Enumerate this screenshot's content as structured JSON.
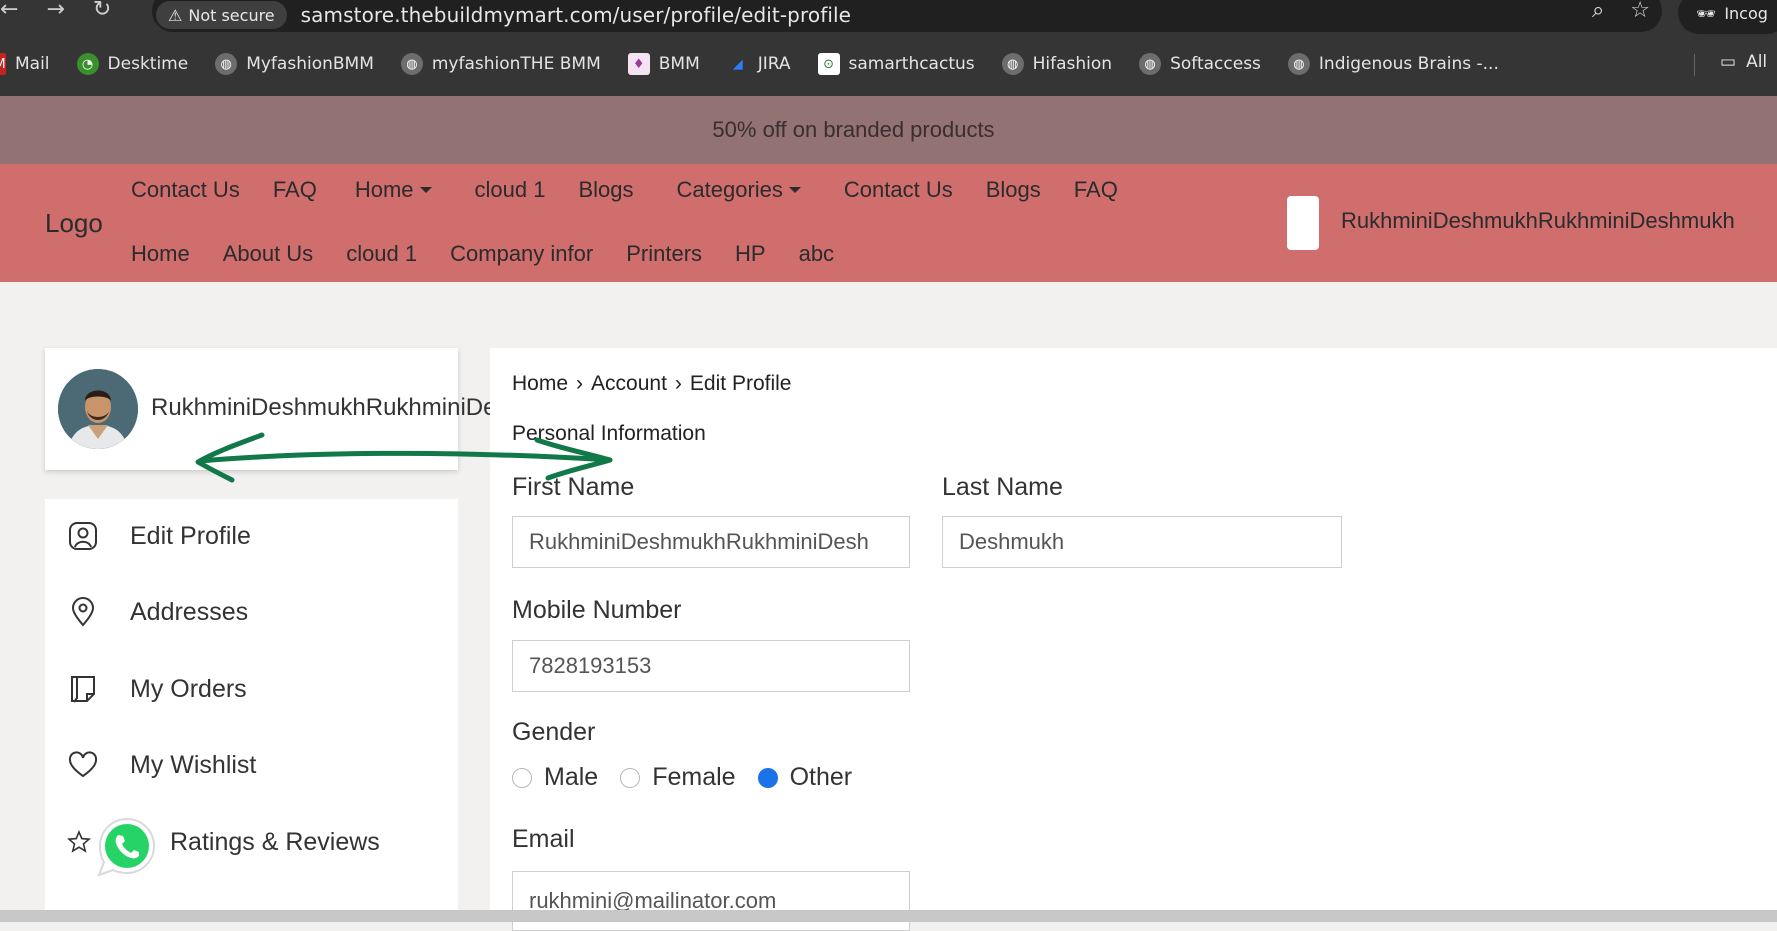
{
  "browser": {
    "security_label": "Not secure",
    "url": "samstore.thebuildmymart.com/user/profile/edit-profile",
    "incognito_label": "Incog",
    "bookmarks": [
      {
        "label": "Mail",
        "icon": "gmail-icon"
      },
      {
        "label": "Desktime",
        "icon": "desktime-icon"
      },
      {
        "label": "MyfashionBMM",
        "icon": "globe-icon"
      },
      {
        "label": "myfashionTHE BMM",
        "icon": "globe-icon"
      },
      {
        "label": "BMM",
        "icon": "bmm-icon"
      },
      {
        "label": "JIRA",
        "icon": "jira-icon"
      },
      {
        "label": "samarthcactus",
        "icon": "cactus-icon"
      },
      {
        "label": "Hifashion",
        "icon": "globe-icon"
      },
      {
        "label": "Softaccess",
        "icon": "globe-icon"
      },
      {
        "label": "Indigenous Brains -...",
        "icon": "globe-icon"
      }
    ],
    "all_bookmarks_label": "All"
  },
  "promo": {
    "text": "50% off on branded products"
  },
  "header": {
    "logo": "Logo",
    "nav_row1": [
      "Contact Us",
      "FAQ",
      "Home",
      "cloud 1",
      "Blogs",
      "Categories",
      "Contact Us",
      "Blogs",
      "FAQ"
    ],
    "nav_row2": [
      "Home",
      "About Us",
      "cloud 1",
      "Company infor",
      "Printers",
      "HP",
      "abc"
    ],
    "user_name": "RukhminiDeshmukhRukhminiDeshmukh"
  },
  "sidebar": {
    "profile_name": "RukhminiDeshmukhRukhminiDeshmukh",
    "menu": [
      {
        "label": "Edit Profile",
        "icon": "user-square-icon"
      },
      {
        "label": "Addresses",
        "icon": "location-pin-icon"
      },
      {
        "label": "My Orders",
        "icon": "orders-icon"
      },
      {
        "label": "My Wishlist",
        "icon": "heart-icon"
      },
      {
        "label": "Ratings & Reviews",
        "icon": "star-icon"
      }
    ]
  },
  "main": {
    "breadcrumb": [
      "Home",
      "Account",
      "Edit Profile"
    ],
    "section_title": "Personal Information",
    "first_name_label": "First Name",
    "first_name_value": "RukhminiDeshmukhRukhminiDesh",
    "last_name_label": "Last Name",
    "last_name_value": "Deshmukh",
    "mobile_label": "Mobile Number",
    "mobile_value": "7828193153",
    "gender_label": "Gender",
    "gender_options": [
      "Male",
      "Female",
      "Other"
    ],
    "gender_selected": "Other",
    "email_label": "Email",
    "email_value": "rukhmini@mailinator.com"
  },
  "colors": {
    "promo_bg": "#927272",
    "header_bg": "#d06e6e",
    "radio_selected": "#1a73e8",
    "annotation_arrow": "#11784a",
    "whatsapp": "#25d366"
  }
}
